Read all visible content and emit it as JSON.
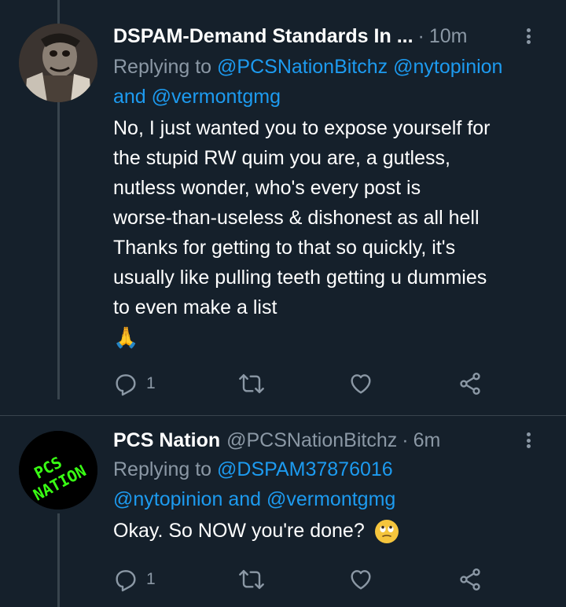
{
  "tweets": [
    {
      "name": "DSPAM-Demand Standards In ...",
      "handle": "",
      "dot": "·",
      "time": "10m",
      "reply_prefix": "Replying to",
      "reply_handles_line1": "@PCSNationBitchz @nytopinion",
      "reply_and": "and",
      "reply_handles_line2": "@vermontgmg",
      "body_lines": [
        "No, I just wanted you to expose yourself for",
        "the stupid RW quim you are, a gutless,",
        "nutless wonder, who's every post is",
        "worse-than-useless & dishonest as all hell",
        "Thanks for getting to that so quickly, it's",
        "usually like pulling teeth getting u dummies",
        "to even make a list"
      ],
      "emoji": "🙏",
      "reply_count": "1"
    },
    {
      "name": "PCS Nation",
      "handle": "@PCSNationBitchz",
      "dot": "·",
      "time": "6m",
      "reply_prefix": "Replying to",
      "reply_handles_line1": "@DSPAM37876016",
      "reply_handles_line2a": "@nytopinion",
      "reply_and": "and",
      "reply_handles_line2b": "@vermontgmg",
      "body": "Okay. So NOW you're done?",
      "reply_count": "1",
      "avatar_text": "PCS NATION"
    }
  ],
  "colors": {
    "background": "#15202b",
    "link": "#1d9bf0",
    "muted": "#8b98a5",
    "avatar2_text": "#39ff14"
  },
  "icons": [
    "reply-icon",
    "retweet-icon",
    "like-icon",
    "share-icon",
    "more-icon"
  ]
}
